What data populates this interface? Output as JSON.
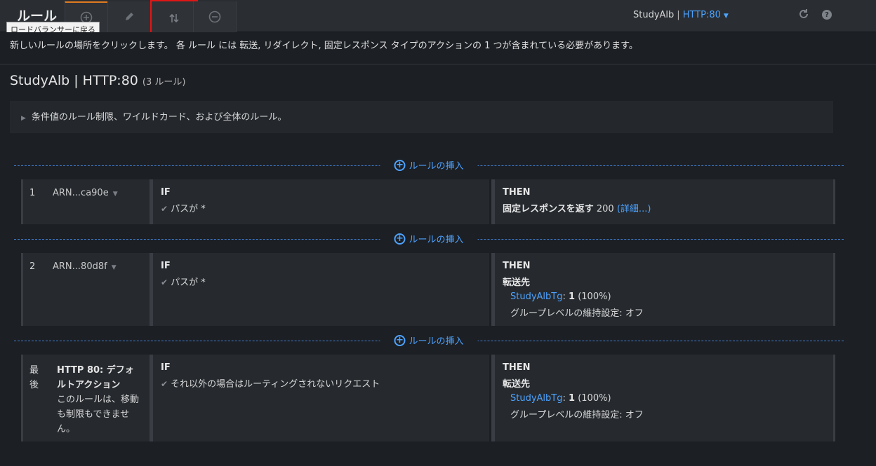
{
  "toolbar": {
    "title": "ルール",
    "tooltip": "ロードバランサーに戻る",
    "lb_name": "StudyAlb",
    "lb_sep": "|",
    "listener": "HTTP:80",
    "icons": [
      "add-icon",
      "edit-icon",
      "reorder-icon",
      "remove-icon",
      "refresh-icon",
      "help-icon"
    ],
    "help_glyph": "?"
  },
  "info": "新しいルールの場所をクリックします。 各 ルール には 転送, リダイレクト, 固定レスポンス タイプのアクションの 1 つが含まれている必要があります。",
  "header": {
    "title": "StudyAlb | HTTP:80",
    "count": "(3 ルール)"
  },
  "expander": "条件値のルール制限、ワイルドカード、および全体のルール。",
  "insert_label": "ルールの挿入",
  "rules": [
    {
      "num": "1",
      "arn": "ARN...ca90e",
      "if_label": "IF",
      "condition": "パスが *",
      "then_label": "THEN",
      "action_bold": "固定レスポンスを返す",
      "action_value": "200",
      "details": "(詳細...)"
    },
    {
      "num": "2",
      "arn": "ARN...80d8f",
      "if_label": "IF",
      "condition": "パスが *",
      "then_label": "THEN",
      "action_bold": "転送先",
      "target": "StudyAlbTg",
      "target_weight_sep": ":",
      "target_weight": "1",
      "target_pct": "(100%)",
      "stickiness": "グループレベルの維持設定: オフ"
    },
    {
      "num": "最後",
      "title": "HTTP 80: デフォルトアクション",
      "desc": "このルールは、移動も制限もできません。",
      "if_label": "IF",
      "condition": "それ以外の場合はルーティングされないリクエスト",
      "then_label": "THEN",
      "action_bold": "転送先",
      "target": "StudyAlbTg",
      "target_weight_sep": ":",
      "target_weight": "1",
      "target_pct": "(100%)",
      "stickiness": "グループレベルの維持設定: オフ"
    }
  ],
  "colors": {
    "accent": "#4da3ff",
    "active_tab": "#e07b1f",
    "highlight": "#e01616",
    "background": "#1c1f24"
  }
}
